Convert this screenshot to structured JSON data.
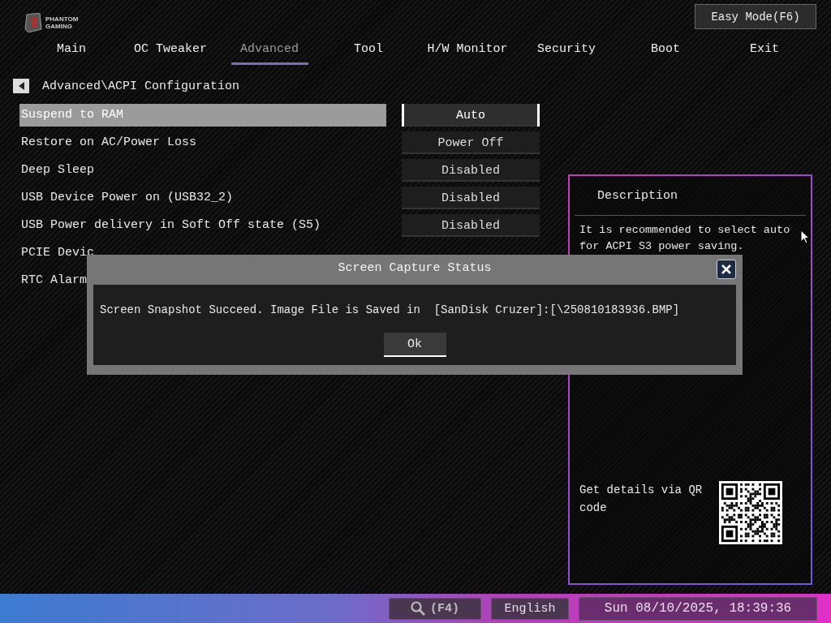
{
  "logo": {
    "line_1": "PHANTOM",
    "line_2": "GAMING"
  },
  "easy_mode_button": "Easy Mode(F6)",
  "tabs": [
    {
      "label": "Main",
      "selected": false
    },
    {
      "label": "OC Tweaker",
      "selected": false
    },
    {
      "label": "Advanced",
      "selected": true
    },
    {
      "label": "Tool",
      "selected": false
    },
    {
      "label": "H/W Monitor",
      "selected": false
    },
    {
      "label": "Security",
      "selected": false
    },
    {
      "label": "Boot",
      "selected": false
    },
    {
      "label": "Exit",
      "selected": false
    }
  ],
  "breadcrumb": "Advanced\\ACPI Configuration",
  "settings": [
    {
      "label": "Suspend to RAM",
      "value": "Auto",
      "selected": true
    },
    {
      "label": "Restore on AC/Power Loss",
      "value": "Power Off",
      "selected": false
    },
    {
      "label": "Deep Sleep",
      "value": "Disabled",
      "selected": false
    },
    {
      "label": "USB Device Power on (USB32_2)",
      "value": "Disabled",
      "selected": false
    },
    {
      "label": "USB Power delivery in Soft Off state (S5)",
      "value": "Disabled",
      "selected": false
    },
    {
      "label": "PCIE Devic",
      "selected": false
    },
    {
      "label": "RTC Alarm",
      "selected": false
    }
  ],
  "description": {
    "title": "Description",
    "text": "It is recommended to select auto for ACPI S3 power saving.",
    "qr_label": "Get details via QR code"
  },
  "dialog": {
    "title": "Screen Capture Status",
    "message": "Screen Snapshot Succeed. Image File is Saved in  [SanDisk Cruzer]:[\\250810183936.BMP]",
    "ok_button": "Ok"
  },
  "status_bar": {
    "search_key": "(F4)",
    "language": "English",
    "datetime": "Sun 08/10/2025, 18:39:36"
  }
}
